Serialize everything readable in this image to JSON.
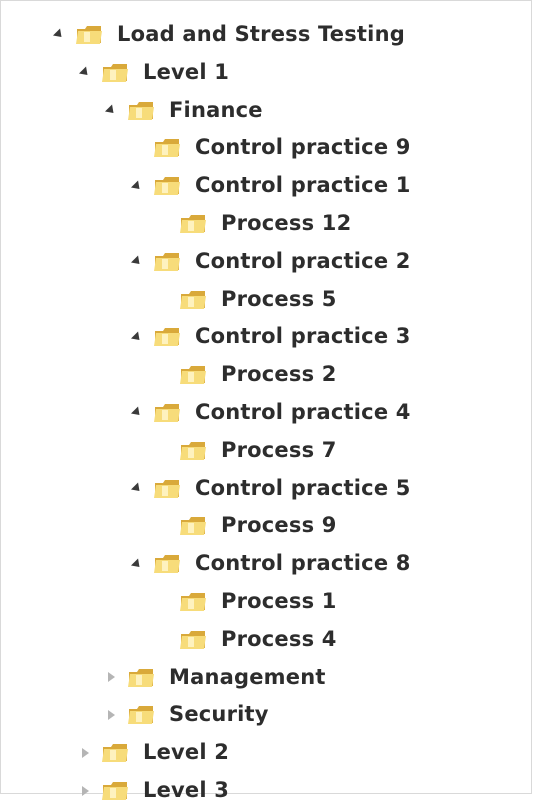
{
  "tree": {
    "nodes": [
      {
        "label": "Load and Stress Testing",
        "level": 0,
        "state": "expanded"
      },
      {
        "label": "Level 1",
        "level": 1,
        "state": "expanded"
      },
      {
        "label": "Finance",
        "level": 2,
        "state": "expanded"
      },
      {
        "label": "Control  practice 9",
        "level": 3,
        "state": "leaf"
      },
      {
        "label": "Control practice 1",
        "level": 3,
        "state": "expanded"
      },
      {
        "label": "Process 12",
        "level": 4,
        "state": "leaf"
      },
      {
        "label": "Control practice 2",
        "level": 3,
        "state": "expanded"
      },
      {
        "label": "Process 5",
        "level": 4,
        "state": "leaf"
      },
      {
        "label": "Control practice 3",
        "level": 3,
        "state": "expanded"
      },
      {
        "label": "Process 2",
        "level": 4,
        "state": "leaf"
      },
      {
        "label": "Control practice 4",
        "level": 3,
        "state": "expanded"
      },
      {
        "label": "Process 7",
        "level": 4,
        "state": "leaf"
      },
      {
        "label": "Control practice 5",
        "level": 3,
        "state": "expanded"
      },
      {
        "label": "Process 9",
        "level": 4,
        "state": "leaf"
      },
      {
        "label": "Control practice 8",
        "level": 3,
        "state": "expanded"
      },
      {
        "label": "Process 1",
        "level": 4,
        "state": "leaf"
      },
      {
        "label": "Process 4",
        "level": 4,
        "state": "leaf"
      },
      {
        "label": "Management",
        "level": 2,
        "state": "collapsed"
      },
      {
        "label": "Security",
        "level": 2,
        "state": "collapsed"
      },
      {
        "label": "Level 2",
        "level": 1,
        "state": "collapsed"
      },
      {
        "label": "Level 3",
        "level": 1,
        "state": "collapsed"
      }
    ]
  },
  "colors": {
    "folder_light": "#f7dc7a",
    "folder_dark": "#d9a93a",
    "text": "#2d2d2d"
  },
  "icons": {
    "folder": "folder-icon",
    "expanded": "expanded-arrow-icon",
    "collapsed": "collapsed-arrow-icon"
  }
}
